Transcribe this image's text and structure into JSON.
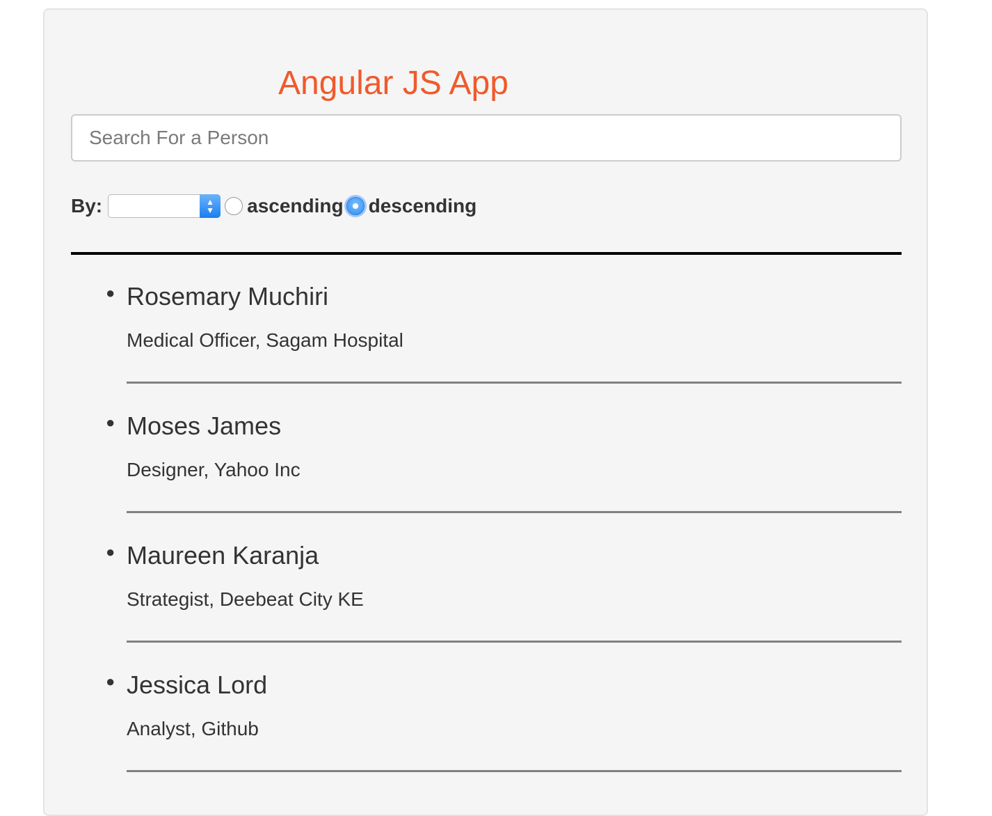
{
  "app": {
    "title": "Angular JS App"
  },
  "search": {
    "placeholder": "Search For a Person",
    "value": ""
  },
  "sort": {
    "by_label": "By:",
    "selected_field": "",
    "ascending_label": "ascending",
    "descending_label": "descending",
    "selected_direction": "descending"
  },
  "people": [
    {
      "name": "Rosemary Muchiri",
      "role": "Medical Officer, Sagam Hospital"
    },
    {
      "name": "Moses James",
      "role": "Designer, Yahoo Inc"
    },
    {
      "name": "Maureen Karanja",
      "role": "Strategist, Deebeat City KE"
    },
    {
      "name": "Jessica Lord",
      "role": "Analyst, Github"
    }
  ],
  "colors": {
    "title": "#f05a2b",
    "panel_bg": "#f5f5f5",
    "accent": "#2f8cf5"
  }
}
